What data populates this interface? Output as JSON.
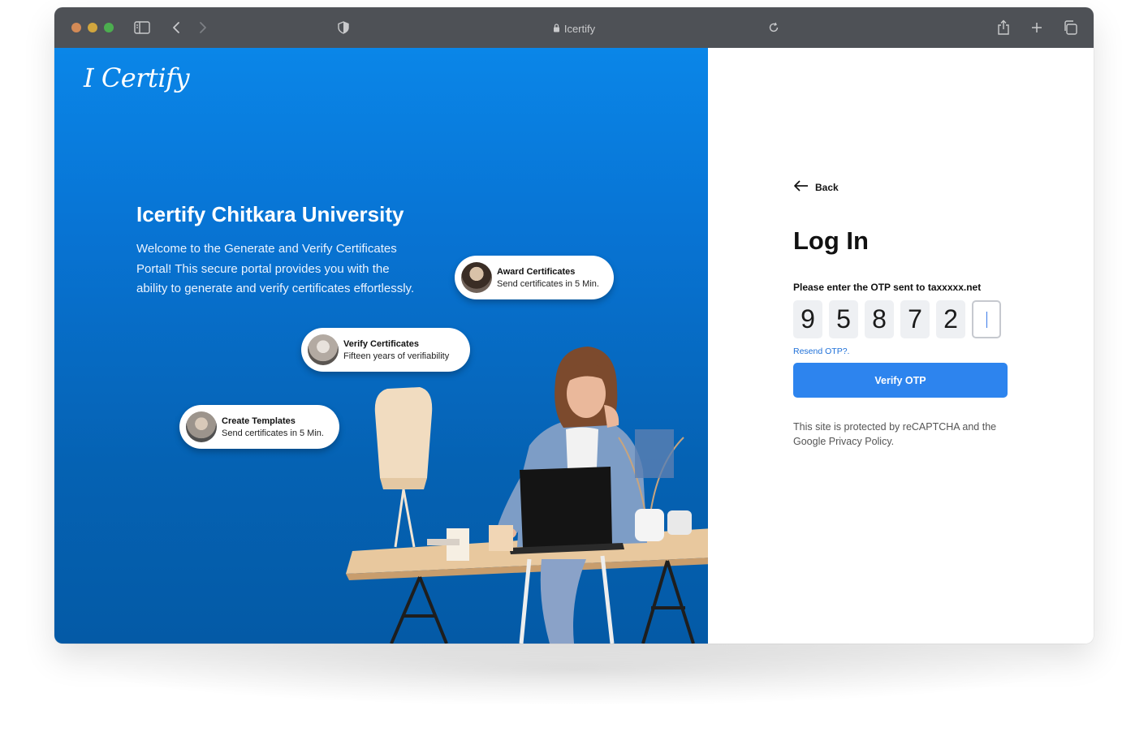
{
  "browser": {
    "url_text": "Icertify",
    "traffic_light_colors": [
      "#d38a56",
      "#d1a63e",
      "#4cae4f"
    ],
    "icons": [
      "sidebar-icon",
      "back-arrow-icon",
      "forward-arrow-icon",
      "shield-icon",
      "lock-icon",
      "reload-icon",
      "share-icon",
      "new-tab-plus-icon",
      "tabs-overview-icon"
    ]
  },
  "hero": {
    "logo_text": "I Certify",
    "headline": "Icertify Chitkara University",
    "intro": "Welcome to the Generate and Verify Certificates Portal! This secure portal provides you with the ability to generate and verify certificates effortlessly.",
    "bg_color": "#0874d4",
    "cards": [
      {
        "title": "Award Certificates",
        "subtitle": "Send certificates in 5 Min."
      },
      {
        "title": "Verify Certificates",
        "subtitle": "Fifteen years of verifiability"
      },
      {
        "title": "Create Templates",
        "subtitle": "Send certificates in 5 Min."
      }
    ]
  },
  "login": {
    "back_label": "Back",
    "title": "Log In",
    "otp_prompt": "Please enter the OTP sent to taxxxxx.net",
    "otp_digits": [
      "9",
      "5",
      "8",
      "7",
      "2",
      ""
    ],
    "resend_label": "Resend OTP?.",
    "verify_label": "Verify OTP",
    "verify_color": "#2d84ee",
    "captcha_note": "This site is protected by reCAPTCHA and the Google Privacy Policy."
  }
}
